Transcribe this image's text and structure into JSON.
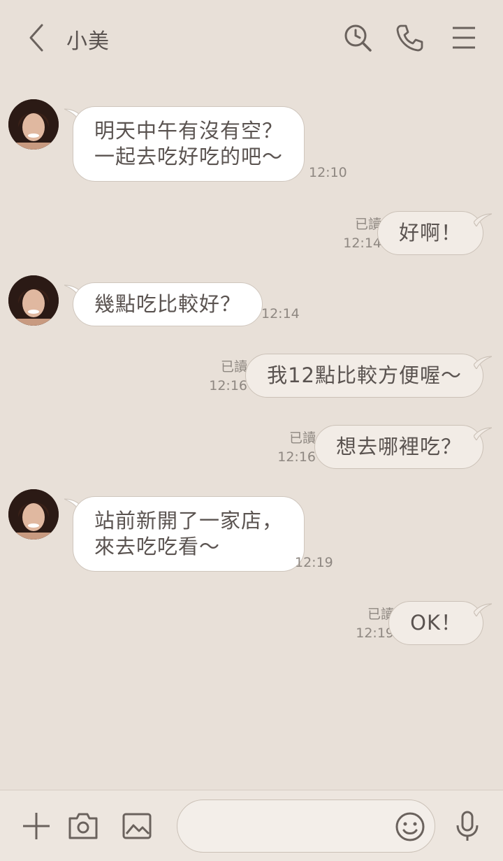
{
  "header": {
    "title": "小美",
    "back_icon": "chevron-left-icon",
    "icons": [
      "search-history-icon",
      "phone-icon",
      "menu-icon"
    ]
  },
  "contact": {
    "avatar": "avatar"
  },
  "messages": [
    {
      "direction": "in",
      "lines": [
        "明天中午有沒有空？",
        "一起去吃好吃的吧～"
      ],
      "time": "12:10"
    },
    {
      "direction": "out",
      "lines": [
        "好啊！"
      ],
      "read": "已讀",
      "time": "12:14"
    },
    {
      "direction": "in",
      "lines": [
        "幾點吃比較好？"
      ],
      "time": "12:14"
    },
    {
      "direction": "out",
      "lines": [
        "我12點比較方便喔～"
      ],
      "read": "已讀",
      "time": "12:16"
    },
    {
      "direction": "out",
      "lines": [
        "想去哪裡吃？"
      ],
      "read": "已讀",
      "time": "12:16"
    },
    {
      "direction": "in",
      "lines": [
        "站前新開了一家店，",
        "來去吃吃看～"
      ],
      "time": "12:19"
    },
    {
      "direction": "out",
      "lines": [
        "OK！"
      ],
      "read": "已讀",
      "time": "12:19"
    }
  ],
  "input": {
    "placeholder": "",
    "value": ""
  },
  "bottom_icons": [
    "plus-icon",
    "camera-icon",
    "image-icon",
    "emoji-icon",
    "microphone-icon"
  ],
  "colors": {
    "background": "#e8e0d8",
    "incoming_bubble": "#ffffff",
    "outgoing_bubble": "#f2ece6",
    "text": "#5a5350",
    "meta_text": "#8e8781"
  }
}
